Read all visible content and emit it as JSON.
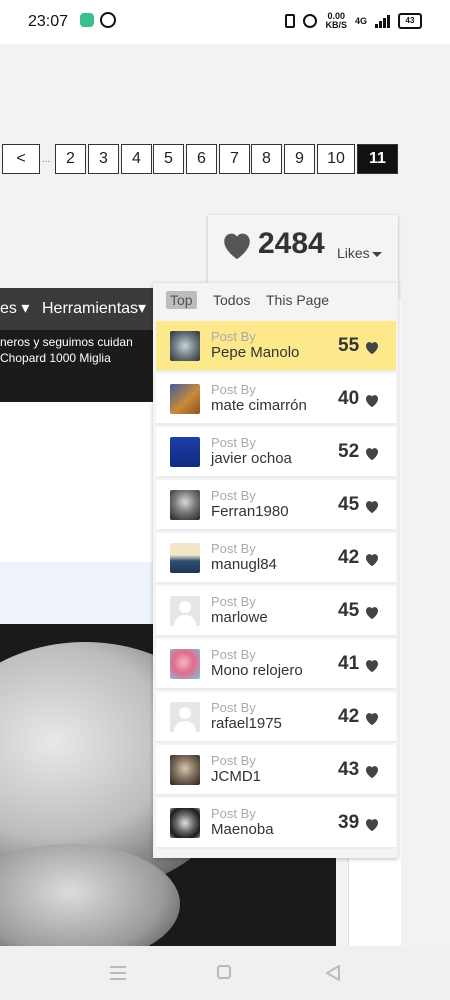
{
  "status_bar": {
    "time": "23:07",
    "speed_value": "0.00",
    "speed_unit": "KB/S",
    "network": "4G",
    "battery": "43"
  },
  "pagination": {
    "prev_label": "<",
    "ellipsis": "...",
    "pages": [
      "2",
      "3",
      "4",
      "5",
      "6",
      "7",
      "8",
      "9",
      "10",
      "11"
    ],
    "current_page": "11"
  },
  "site": {
    "menu_partial": "es",
    "menu_tools": "Herramientas",
    "caption_line1": "neros y seguimos cuidan",
    "caption_line2": "Chopard 1000 Miglia"
  },
  "likes": {
    "count": "2484",
    "label": "Likes",
    "tabs": [
      "Top",
      "Todos",
      "This Page"
    ],
    "active_tab": "Top",
    "post_by_label": "Post By",
    "rows": [
      {
        "user": "Pepe Manolo",
        "count": "55",
        "avatar": "watch-avatar",
        "highlight": true
      },
      {
        "user": "mate cimarrón",
        "count": "40",
        "avatar": "mate-avatar"
      },
      {
        "user": "javier ochoa",
        "count": "52",
        "avatar": "blue-avatar"
      },
      {
        "user": "Ferran1980",
        "count": "45",
        "avatar": "portrait-avatar"
      },
      {
        "user": "manugl84",
        "count": "42",
        "avatar": "wave-avatar"
      },
      {
        "user": "marlowe",
        "count": "45",
        "avatar": "default-avatar"
      },
      {
        "user": "Mono relojero",
        "count": "41",
        "avatar": "cartoon-avatar"
      },
      {
        "user": "rafael1975",
        "count": "42",
        "avatar": "default-avatar"
      },
      {
        "user": "JCMD1",
        "count": "43",
        "avatar": "face-avatar"
      },
      {
        "user": "Maenoba",
        "count": "39",
        "avatar": "watch-avatar"
      }
    ]
  },
  "colors": {
    "highlight": "#fde98c",
    "current_page_bg": "#111111"
  }
}
